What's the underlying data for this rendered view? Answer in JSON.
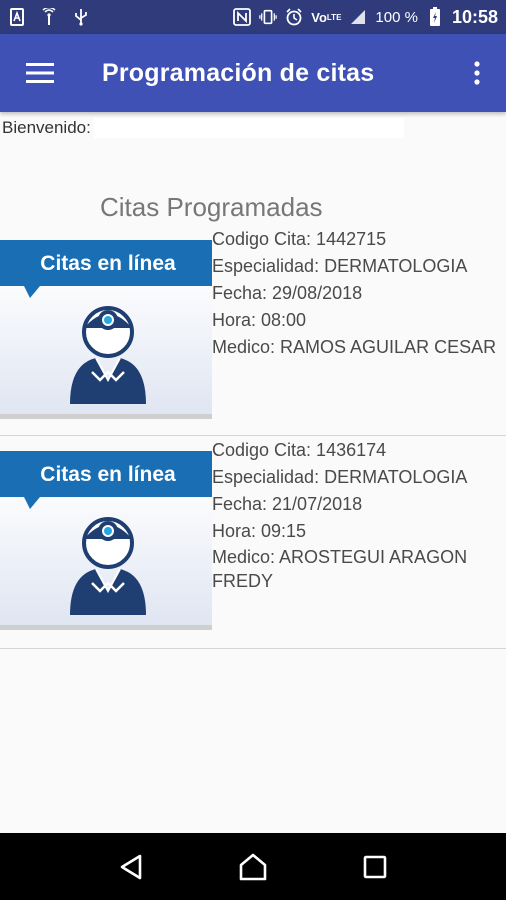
{
  "status_bar": {
    "battery_percent": "100 %",
    "time": "10:58",
    "network_label": "LTE",
    "icons": [
      "app-icon",
      "hotspot-icon",
      "usb-icon",
      "nfc-icon",
      "vibrate-icon",
      "alarm-icon",
      "volte-icon",
      "signal-icon",
      "battery-icon"
    ]
  },
  "app_bar": {
    "title": "Programación de citas",
    "menu_icon": "hamburger-menu-icon",
    "overflow_icon": "more-vert-icon"
  },
  "welcome": {
    "label": "Bienvenido:",
    "value": ""
  },
  "section_title": "Citas Programadas",
  "thumbnail_caption": "Citas en línea",
  "appointments": [
    {
      "codigo": "Codigo Cita: 1442715",
      "especialidad": "Especialidad: DERMATOLOGIA",
      "fecha": "Fecha: 29/08/2018",
      "hora": "Hora: 08:00",
      "medico": "Medico: RAMOS AGUILAR CESAR"
    },
    {
      "codigo": "Codigo Cita: 1436174",
      "especialidad": "Especialidad: DERMATOLOGIA",
      "fecha": "Fecha: 21/07/2018",
      "hora": "Hora: 09:15",
      "medico": "Medico: AROSTEGUI ARAGON FREDY"
    }
  ],
  "nav_bar": {
    "back_icon": "back-triangle-icon",
    "home_icon": "home-icon",
    "recents_icon": "recents-square-icon"
  },
  "colors": {
    "status_bar": "#2f3b7a",
    "app_bar": "#3f51b5",
    "banner_blue": "#1a6fb4",
    "doctor_navy": "#1f3f73"
  }
}
